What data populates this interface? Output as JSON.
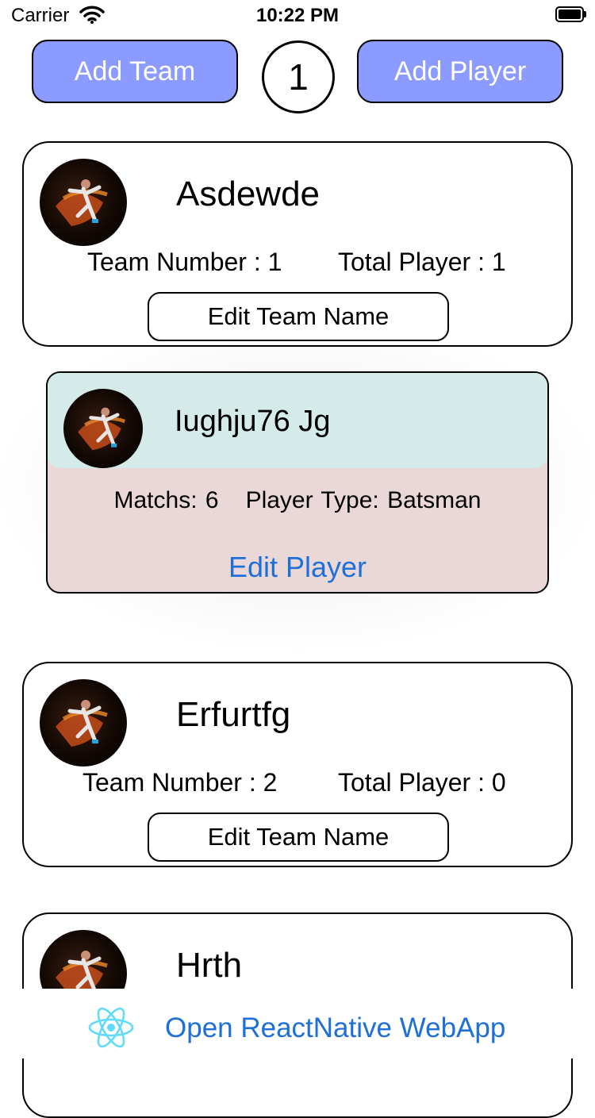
{
  "status_bar": {
    "carrier": "Carrier",
    "time": "10:22 PM"
  },
  "toolbar": {
    "add_team_label": "Add Team",
    "counter": "1",
    "add_player_label": "Add Player"
  },
  "teams": [
    {
      "name": "Asdewde",
      "number_text": "Team Number : 1",
      "total_text": "Total Player : 1",
      "edit_label": "Edit Team Name"
    },
    {
      "name": "Erfurtfg",
      "number_text": "Team Number : 2",
      "total_text": "Total Player : 0",
      "edit_label": "Edit Team Name"
    },
    {
      "name": "Hrth"
    }
  ],
  "player": {
    "name": "Iughju76 Jg",
    "matches_text": "Matchs: 6",
    "type_text": "Player Type: Batsman",
    "edit_label": "Edit Player"
  },
  "footer": {
    "link_label": "Open ReactNative WebApp",
    "icon": "react-icon"
  },
  "colors": {
    "button_bg": "#8c9bff",
    "player_header": "#d5ebea",
    "player_body": "#ead8d8",
    "link": "#1f6fd9"
  }
}
